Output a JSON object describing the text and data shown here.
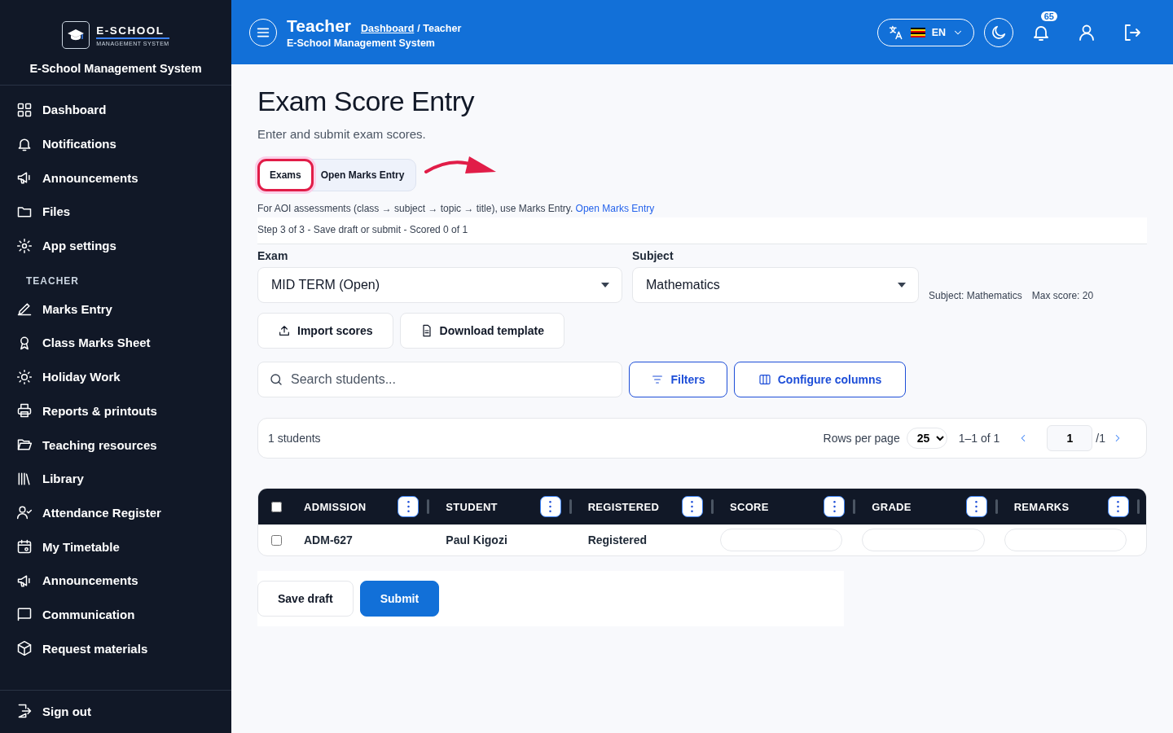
{
  "sidebar": {
    "logo": {
      "wordmark": "E-SCHOOL",
      "tagline": "MANAGEMENT SYSTEM"
    },
    "title": "E-School Management System",
    "items": [
      {
        "label": "Dashboard"
      },
      {
        "label": "Notifications"
      },
      {
        "label": "Announcements"
      },
      {
        "label": "Files"
      },
      {
        "label": "App settings"
      }
    ],
    "section_label": "TEACHER",
    "teacher_items": [
      {
        "label": "Marks Entry"
      },
      {
        "label": "Class Marks Sheet"
      },
      {
        "label": "Holiday Work"
      },
      {
        "label": "Reports & printouts"
      },
      {
        "label": "Teaching resources"
      },
      {
        "label": "Library"
      },
      {
        "label": "Attendance Register"
      },
      {
        "label": "My Timetable"
      },
      {
        "label": "Announcements"
      },
      {
        "label": "Communication"
      },
      {
        "label": "Request materials"
      }
    ],
    "sign_out": "Sign out"
  },
  "header": {
    "title": "Teacher",
    "breadcrumb_link": "Dashboard",
    "breadcrumb_current": "/ Teacher",
    "subtitle": "E-School Management System",
    "language": "EN",
    "notification_count": "65"
  },
  "page": {
    "title": "Exam Score Entry",
    "subtitle": "Enter and submit exam scores.",
    "tabs": [
      {
        "label": "Exams",
        "selected": true,
        "highlighted": true
      },
      {
        "label": "Open Marks Entry",
        "selected": false,
        "highlighted": false
      }
    ],
    "note": {
      "text": "For AOI assessments (class → subject → topic → title), use Marks Entry.",
      "link": "Open Marks Entry"
    },
    "step": "Step 3 of 3 - Save draft or submit - Scored 0 of 1",
    "exam": {
      "label": "Exam",
      "value": "MID TERM (Open)"
    },
    "subject": {
      "label": "Subject",
      "value": "Mathematics"
    },
    "subject_info": "Subject: Mathematics",
    "max_score": "Max score: 20",
    "buttons": [
      "Import scores",
      "Download template"
    ],
    "search": {
      "placeholder": "Search students..."
    },
    "filters": "Filters",
    "configure": "Configure columns",
    "pagination": {
      "count": "1 students",
      "rows_label": "Rows per page",
      "rows_value": "25",
      "range": "1–1 of 1",
      "page": "1",
      "total": "/1"
    },
    "table": {
      "all_checked": false,
      "columns": [
        {
          "label": "ADMISSION",
          "kind": "text"
        },
        {
          "label": "STUDENT",
          "kind": "text"
        },
        {
          "label": "REGISTERED",
          "kind": "text"
        },
        {
          "label": "SCORE",
          "kind": "input"
        },
        {
          "label": "GRADE",
          "kind": "input"
        },
        {
          "label": "REMARKS",
          "kind": "input"
        }
      ],
      "rows": [
        {
          "checked": false,
          "cells": [
            "ADM-627",
            "Paul Kigozi",
            "Registered"
          ]
        }
      ]
    },
    "actions": [
      {
        "label": "Save draft",
        "kind": "secondary"
      },
      {
        "label": "Submit",
        "kind": "primary"
      }
    ]
  }
}
